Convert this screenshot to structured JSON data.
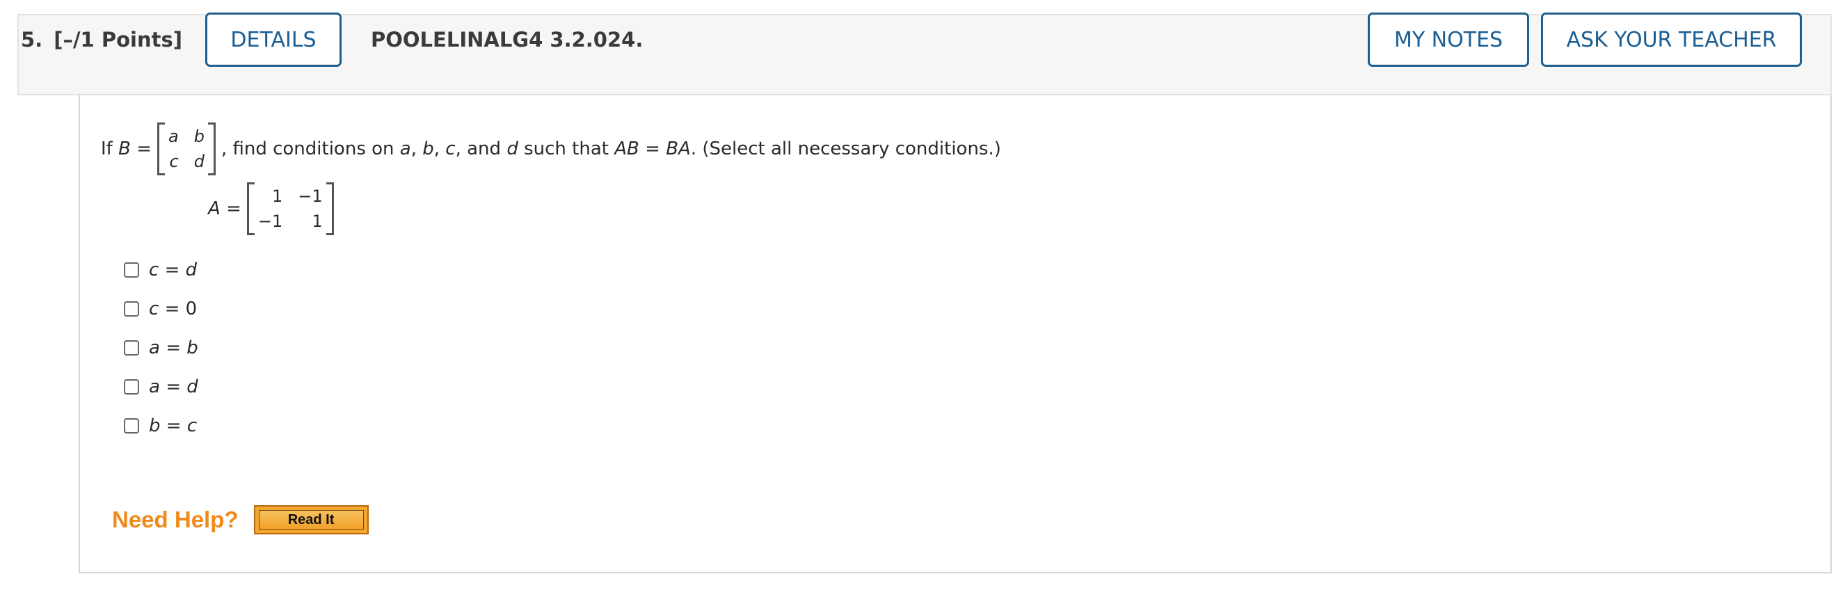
{
  "question": {
    "number": "5.",
    "points": "[–/1 Points]",
    "id": "POOLELINALG4 3.2.024."
  },
  "toolbar": {
    "details_label": "DETAILS",
    "my_notes_label": "MY NOTES",
    "ask_teacher_label": "ASK YOUR TEACHER"
  },
  "prompt": {
    "prefix": "If",
    "var_b": "B",
    "eq": "=",
    "matrix_b": [
      "a",
      "b",
      "c",
      "d"
    ],
    "text_1": ", find conditions on",
    "var_a": "a",
    "sep1": ",",
    "var_b2": "b",
    "sep2": ",",
    "var_c": "c",
    "sep3": ", and",
    "var_d": "d",
    "text_2": "such that",
    "ab": "AB",
    "eq2": "=",
    "ba": "BA",
    "text_3": ". (Select all necessary conditions.)"
  },
  "matrix_a": {
    "label": "A",
    "eq": "=",
    "cells": [
      "1",
      "−1",
      "−1",
      "1"
    ]
  },
  "options": [
    {
      "lhs": "c",
      "op": "=",
      "rhs": "d"
    },
    {
      "lhs": "c",
      "op": "=",
      "rhs": "0"
    },
    {
      "lhs": "a",
      "op": "=",
      "rhs": "b"
    },
    {
      "lhs": "a",
      "op": "=",
      "rhs": "d"
    },
    {
      "lhs": "b",
      "op": "=",
      "rhs": "c"
    }
  ],
  "help": {
    "label": "Need Help?",
    "read_it_label": "Read It"
  }
}
